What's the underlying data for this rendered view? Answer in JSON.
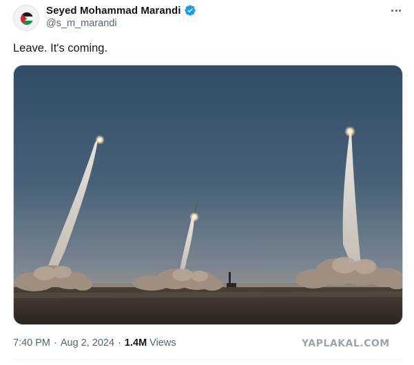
{
  "author": {
    "display_name": "Seyed Mohammad Marandi",
    "handle": "@s_m_marandi",
    "verified": true,
    "avatar_icon": "palestine-flag-avatar"
  },
  "tweet": {
    "text": "Leave. It's coming.",
    "media": {
      "type": "photo",
      "description_icon": "missile-launch-photo"
    }
  },
  "meta": {
    "time": "7:40 PM",
    "separator": "·",
    "date": "Aug 2, 2024",
    "views_count": "1.4M",
    "views_label": "Views"
  },
  "watermark": "YAPLAKAL.COM",
  "colors": {
    "text_primary": "#0f1419",
    "text_secondary": "#536471",
    "verified_blue": "#1d9bf0",
    "border": "#cfd9de"
  },
  "icons": {
    "more": "more-options-icon",
    "verified": "verified-badge-icon"
  }
}
